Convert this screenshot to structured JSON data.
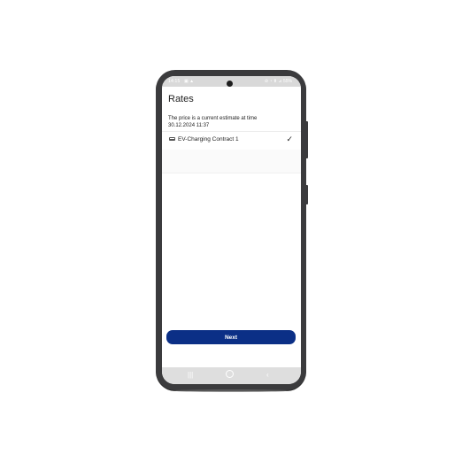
{
  "status": {
    "time": "14:15",
    "left_icons": "▣ ▲",
    "right_icons": "⊘ ◔ ⬆ ⊿ 55%"
  },
  "header": {
    "title": "Rates"
  },
  "info": {
    "line1": "The price is a current estimate at time",
    "line2": "30.12.2024 11:37"
  },
  "contract": {
    "label": "EV-Charging Contract 1",
    "check": "✓",
    "icon": "credit-card-icon"
  },
  "actions": {
    "next_label": "Next"
  },
  "navbar": {
    "recent": "|||",
    "back": "‹"
  },
  "colors": {
    "primary": "#0b2f86",
    "phone_frame": "#3b3b3d",
    "status_bar": "#d9d9d9"
  }
}
